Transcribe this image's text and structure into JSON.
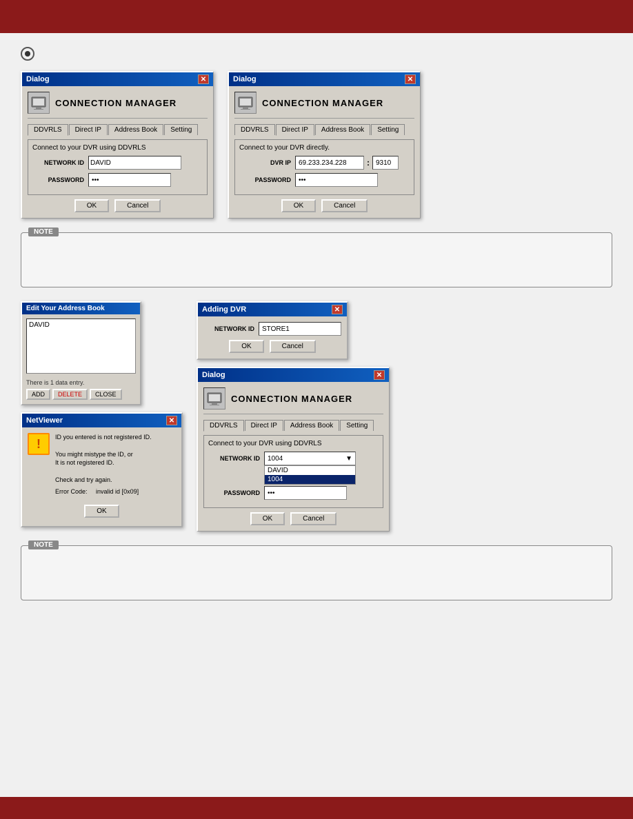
{
  "header": {
    "title": ""
  },
  "radio_icon": "⊙",
  "dialogs_row1": [
    {
      "id": "dialog1",
      "title": "Dialog",
      "header_icon": "🖥",
      "header_title": "CONNECTION MANAGER",
      "tabs": [
        "DDVRLS",
        "Direct IP",
        "Address Book",
        "Setting"
      ],
      "active_tab": "DDVRLS",
      "subtitle": "Connect to your DVR using DDVRLS",
      "fields": [
        {
          "label": "NETWORK ID",
          "value": "DAVID",
          "type": "select"
        },
        {
          "label": "PASSWORD",
          "value": "***",
          "type": "password"
        }
      ],
      "buttons": [
        "OK",
        "Cancel"
      ]
    },
    {
      "id": "dialog2",
      "title": "Dialog",
      "header_icon": "🖥",
      "header_title": "CONNECTION MANAGER",
      "tabs": [
        "DDVRLS",
        "Direct IP",
        "Address Book",
        "Setting"
      ],
      "active_tab": "Direct IP",
      "subtitle": "Connect to your DVR directly.",
      "fields": [
        {
          "label": "DVR IP",
          "ip": "69.233.234.228",
          "port": "9310",
          "type": "ip"
        },
        {
          "label": "PASSWORD",
          "value": "***",
          "type": "password"
        }
      ],
      "buttons": [
        "OK",
        "Cancel"
      ]
    }
  ],
  "note_box_1": {
    "label": "NOTE",
    "text": ""
  },
  "address_book_dialog": {
    "title": "Edit Your Address Book",
    "list_items": [
      "DAVID"
    ],
    "footer_text": "There is 1 data entry.",
    "buttons": [
      "ADD",
      "DELETE",
      "CLOSE"
    ]
  },
  "adding_dvr_dialog": {
    "title": "Adding DVR",
    "fields": [
      {
        "label": "NETWORK ID",
        "value": "STORE1"
      }
    ],
    "buttons": [
      "OK",
      "Cancel"
    ]
  },
  "netviewer_dialog": {
    "title": "NetViewer",
    "warning_icon": "!",
    "message_line1": "ID you entered is not registered ID.",
    "message_line2": "You might mistype the ID, or",
    "message_line3": "It is not registered ID.",
    "message_line4": "Check and try again.",
    "error_label": "Error Code:",
    "error_value": "invalid id [0x09]",
    "buttons": [
      "OK"
    ]
  },
  "connection_manager_dropdown": {
    "title": "Dialog",
    "header_title": "CONNECTION MANAGER",
    "tabs": [
      "DDVRLS",
      "Direct IP",
      "Address Book",
      "Setting"
    ],
    "active_tab": "DDVRLS",
    "subtitle": "Connect to your DVR using DDVRLS",
    "network_id_value": "1004",
    "dropdown_items": [
      "DAVID",
      "1004"
    ],
    "selected_dropdown": "1004",
    "password_label": "PASSWORD",
    "password_value": "***",
    "buttons": [
      "OK",
      "Cancel"
    ]
  },
  "note_box_2": {
    "label": "NOTE",
    "text": ""
  }
}
